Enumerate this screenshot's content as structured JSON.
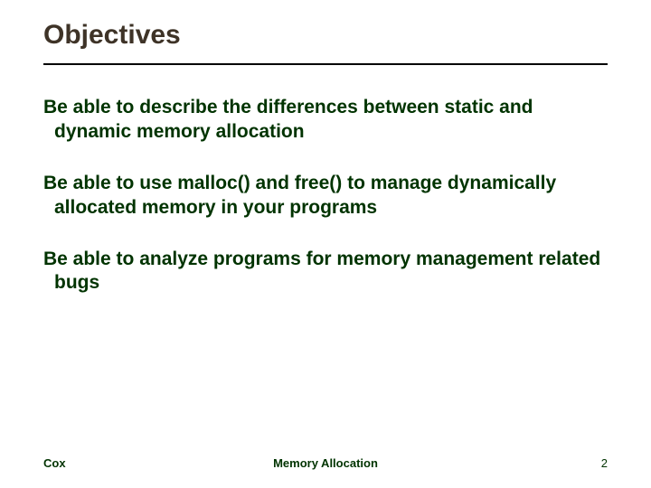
{
  "title": "Objectives",
  "bullets": [
    "Be able to describe the differences between static and dynamic memory allocation",
    "Be able to use malloc() and free() to manage dynamically allocated memory in your programs",
    "Be able to analyze programs for memory management related bugs"
  ],
  "footer": {
    "left": "Cox",
    "center": "Memory Allocation",
    "right": "2"
  }
}
